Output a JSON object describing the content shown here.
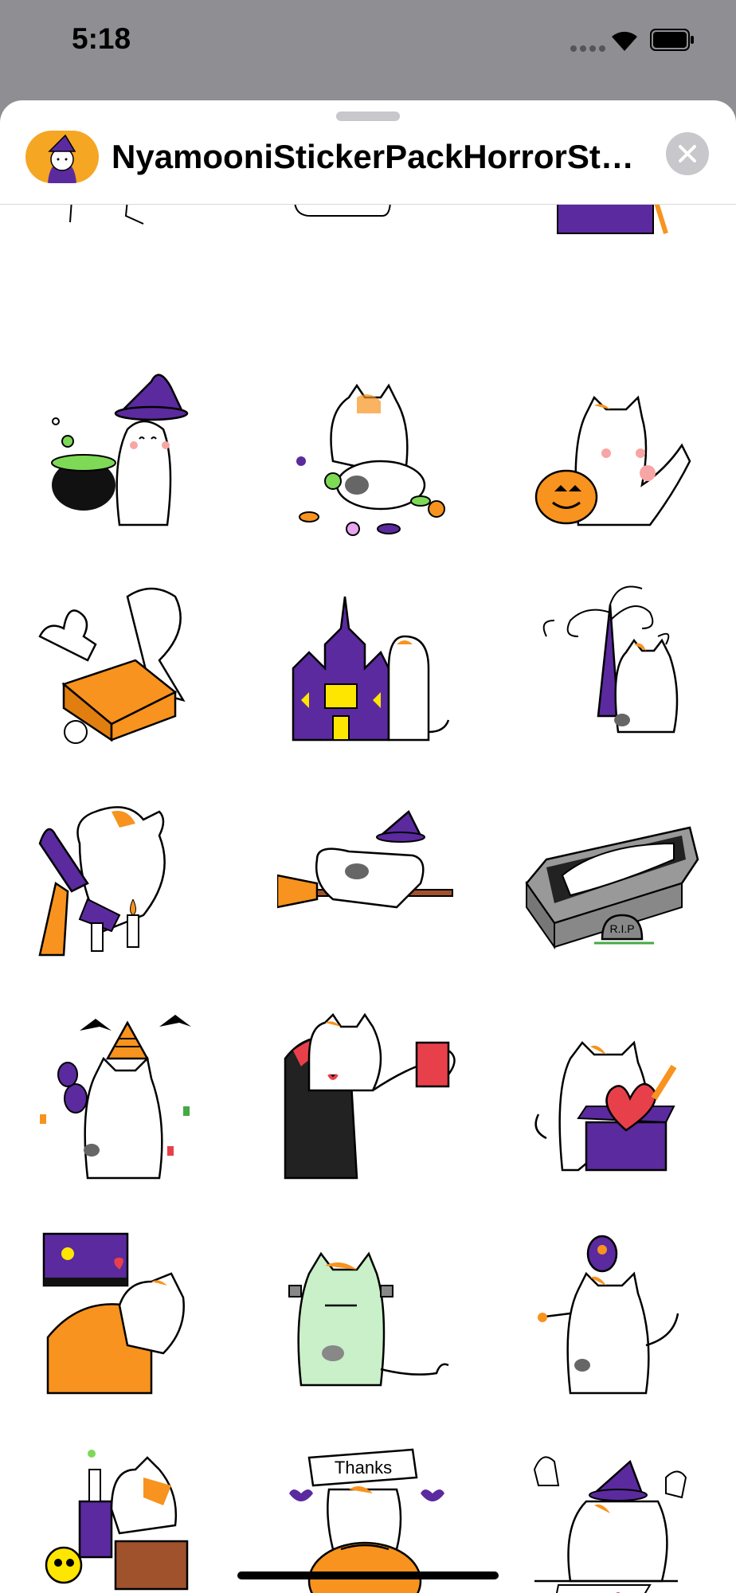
{
  "status_bar": {
    "time": "5:18"
  },
  "sheet": {
    "title": "NyamooniStickerPackHorrorSt…",
    "app_icon": "witch-cat-app-icon",
    "close_icon": "close-x-icon"
  },
  "stickers": [
    {
      "name": "cat-witch-cauldron"
    },
    {
      "name": "cat-candy-pile"
    },
    {
      "name": "cat-jack-o-lantern"
    },
    {
      "name": "cat-ghost-box"
    },
    {
      "name": "cat-haunted-castle"
    },
    {
      "name": "cat-spooky-tree"
    },
    {
      "name": "cat-broom-candles"
    },
    {
      "name": "cat-flying-broom"
    },
    {
      "name": "cat-coffin"
    },
    {
      "name": "cat-party-maracas"
    },
    {
      "name": "cat-vampire-drink"
    },
    {
      "name": "cat-heart-box"
    },
    {
      "name": "cat-sleep-bed"
    },
    {
      "name": "cat-frankenstein"
    },
    {
      "name": "cat-owl-shoulder"
    },
    {
      "name": "cat-skull-potion"
    },
    {
      "name": "cat-pumpkin-thanks"
    },
    {
      "name": "cat-witch-ghosts"
    }
  ],
  "texts": {
    "thanks": "Thanks",
    "rip": "R.I.P"
  },
  "colors": {
    "orange": "#f7931e",
    "purple": "#5b2a9e",
    "green": "#c9f0c9",
    "red": "#e8404a"
  }
}
